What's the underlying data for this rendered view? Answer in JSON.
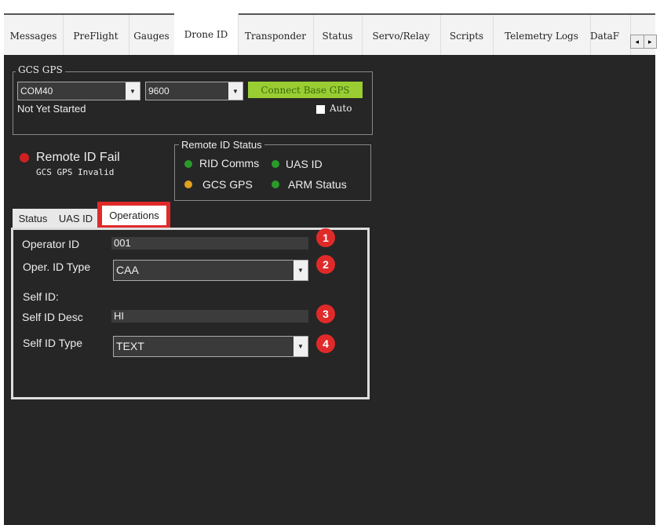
{
  "tabs": [
    "Messages",
    "PreFlight",
    "Gauges",
    "Drone ID",
    "Transponder",
    "Status",
    "Servo/Relay",
    "Scripts",
    "Telemetry Logs",
    "DataF"
  ],
  "gcs_gps": {
    "title": "GCS GPS",
    "port": "COM40",
    "baud": "9600",
    "connect_label": "Connect Base GPS",
    "status": "Not Yet Started",
    "auto_label": "Auto"
  },
  "remote_id": {
    "state": "Remote ID Fail",
    "detail": "GCS GPS Invalid"
  },
  "rid_status": {
    "title": "Remote ID Status",
    "items": [
      "RID Comms",
      "UAS ID",
      "GCS GPS",
      "ARM Status"
    ]
  },
  "subtabs": [
    "Status",
    "UAS ID",
    "Operations"
  ],
  "operations": {
    "operator_id_label": "Operator ID",
    "operator_id": "001",
    "oper_id_type_label": "Oper. ID Type",
    "oper_id_type": "CAA",
    "self_id_label": "Self ID:",
    "self_id_desc_label": "Self ID Desc",
    "self_id_desc": "HI",
    "self_id_type_label": "Self ID Type",
    "self_id_type": "TEXT"
  },
  "badges": [
    "1",
    "2",
    "3",
    "4"
  ],
  "colors": {
    "bg": "#262626",
    "button": "#9acd32",
    "led_red": "#d02020",
    "led_green": "#2a9a2a",
    "led_orange": "#e0a020",
    "highlight": "#e02a2a"
  }
}
